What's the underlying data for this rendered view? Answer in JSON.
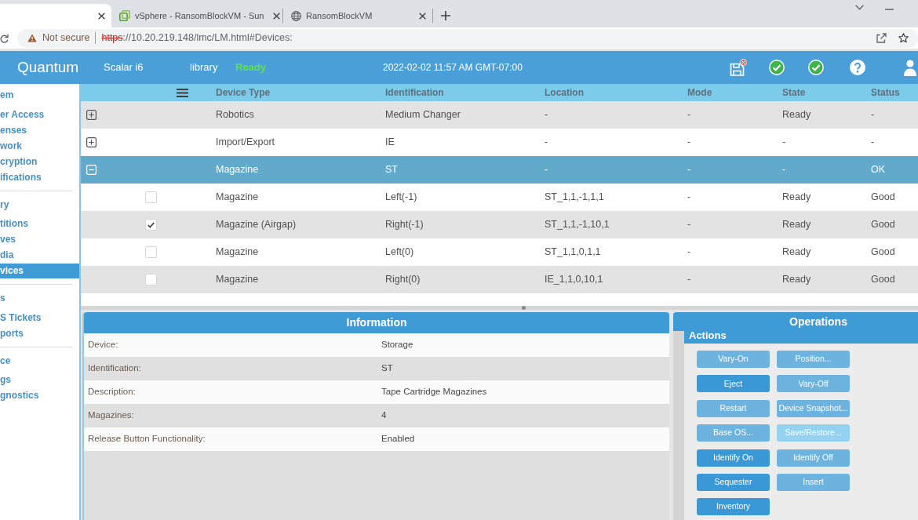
{
  "browser": {
    "tabs": [
      {
        "kind": "blank",
        "selected": true
      },
      {
        "title": "vSphere - RansomBlockVM - Sun",
        "kind": "squares",
        "selected": false
      },
      {
        "title": "RansomBlockVM",
        "kind": "globe",
        "selected": false
      }
    ],
    "address_bar": {
      "security_label": "Not secure",
      "url_scheme": "https",
      "url_rest": "://10.20.219.148/lmc/LM.html#Devices:"
    }
  },
  "app_header": {
    "brand": "Quantum",
    "product": "Scalar i6",
    "library_label": "library",
    "library_status": "Ready",
    "datetime": "2022-02-02 11:57 AM GMT-07:00"
  },
  "sidebar": {
    "groups": [
      {
        "title": "em",
        "items": [
          {
            "label": "er Access",
            "selected": false
          },
          {
            "label": "enses",
            "selected": false
          },
          {
            "label": "work",
            "selected": false
          },
          {
            "label": "cryption",
            "selected": false
          },
          {
            "label": "ifications",
            "selected": false
          }
        ]
      },
      {
        "title": "ry",
        "items": [
          {
            "label": "titions",
            "selected": false
          },
          {
            "label": "ves",
            "selected": false
          },
          {
            "label": "dia",
            "selected": false
          },
          {
            "label": "vices",
            "selected": true
          }
        ]
      },
      {
        "title": "s",
        "items": [
          {
            "label": "S Tickets",
            "selected": false
          },
          {
            "label": "ports",
            "selected": false
          }
        ]
      },
      {
        "title": "ce",
        "items": [
          {
            "label": "gs",
            "selected": false
          },
          {
            "label": "gnostics",
            "selected": false
          }
        ]
      }
    ]
  },
  "devices_table": {
    "columns": [
      "Device Type",
      "Identification",
      "Location",
      "Mode",
      "State",
      "Status"
    ],
    "rows": [
      {
        "cells": [
          "Robotics",
          "Medium Changer",
          "-",
          "-",
          "Ready",
          "-"
        ],
        "expanded": false,
        "selected": false
      },
      {
        "cells": [
          "Import/Export",
          "IE",
          "-",
          "-",
          "-",
          "-"
        ],
        "expanded": false,
        "selected": false
      },
      {
        "cells": [
          "Magazine",
          "ST",
          "-",
          "-",
          "-",
          "OK"
        ],
        "expanded": true,
        "selected": true,
        "children": [
          {
            "cells": [
              "Magazine",
              "Left(-1)",
              "ST_1,1,-1,1,1",
              "-",
              "Ready",
              "Good"
            ],
            "checked": false
          },
          {
            "cells": [
              "Magazine (Airgap)",
              "Right(-1)",
              "ST_1,1,-1,10,1",
              "-",
              "Ready",
              "Good"
            ],
            "checked": true
          },
          {
            "cells": [
              "Magazine",
              "Left(0)",
              "ST_1,1,0,1,1",
              "-",
              "Ready",
              "Good"
            ],
            "checked": false
          },
          {
            "cells": [
              "Magazine",
              "Right(0)",
              "IE_1,1,0,10,1",
              "-",
              "Ready",
              "Good"
            ],
            "checked": false
          }
        ]
      }
    ]
  },
  "information": {
    "title": "Information",
    "fields": [
      {
        "label": "Device:",
        "value": "Storage"
      },
      {
        "label": "Identification:",
        "value": "ST"
      },
      {
        "label": "Description:",
        "value": "Tape Cartridge Magazines"
      },
      {
        "label": "Magazines:",
        "value": "4"
      },
      {
        "label": "Release Button Functionality:",
        "value": "Enabled"
      }
    ]
  },
  "operations": {
    "title": "Operations",
    "section": "Actions",
    "buttons": [
      {
        "label": "Vary-On",
        "disabled": true,
        "highlighted": false
      },
      {
        "label": "Position...",
        "disabled": true,
        "highlighted": false
      },
      {
        "label": "Eject",
        "disabled": false,
        "highlighted": false
      },
      {
        "label": "Vary-Off",
        "disabled": true,
        "highlighted": false
      },
      {
        "label": "Restart",
        "disabled": true,
        "highlighted": false
      },
      {
        "label": "Device Snapshot...",
        "disabled": true,
        "highlighted": false
      },
      {
        "label": "Base OS...",
        "disabled": true,
        "highlighted": false
      },
      {
        "label": "Save/Restore...",
        "disabled": true,
        "highlighted": true
      },
      {
        "label": "Identify On",
        "disabled": false,
        "highlighted": false
      },
      {
        "label": "Identify Off",
        "disabled": true,
        "highlighted": false
      },
      {
        "label": "Sequester",
        "disabled": false,
        "highlighted": false
      },
      {
        "label": "Insert",
        "disabled": true,
        "highlighted": false
      },
      {
        "label": "Inventory",
        "disabled": false,
        "highlighted": false
      }
    ]
  }
}
